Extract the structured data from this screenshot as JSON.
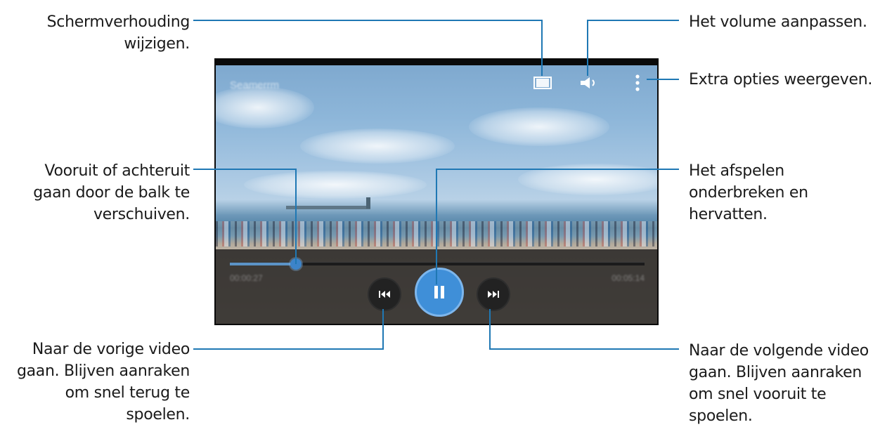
{
  "player": {
    "video_title": "Seamerrm",
    "time_elapsed": "00:00:27",
    "time_total": "00:05:14",
    "progress_fraction": 0.16,
    "accent_color": "#3f8fd8"
  },
  "icons": {
    "aspect": "aspect-ratio-icon",
    "volume": "speaker-icon",
    "more": "more-vertical-icon",
    "prev": "skip-previous-icon",
    "pause": "pause-icon",
    "next": "skip-next-icon"
  },
  "callouts": {
    "aspect_ratio": [
      "Schermverhouding",
      "wijzigen."
    ],
    "seek": [
      "Vooruit of achteruit",
      "gaan door de balk te",
      "verschuiven."
    ],
    "previous": [
      "Naar de vorige video",
      "gaan. Blijven aanraken",
      "om snel terug te",
      "spoelen."
    ],
    "volume": [
      "Het volume aanpassen."
    ],
    "options": [
      "Extra opties weergeven."
    ],
    "pause": [
      "Het afspelen",
      "onderbreken en",
      "hervatten."
    ],
    "next": [
      "Naar de volgende video",
      "gaan. Blijven aanraken",
      "om snel vooruit te",
      "spoelen."
    ]
  }
}
